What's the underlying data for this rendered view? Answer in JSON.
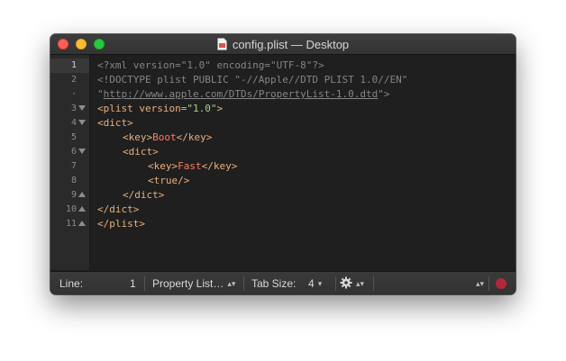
{
  "window": {
    "title": "config.plist — Desktop",
    "file_icon": "plist-document-icon"
  },
  "gutter": {
    "lines": [
      {
        "num": "1",
        "fold": "none",
        "current": true
      },
      {
        "num": "2",
        "fold": "none"
      },
      {
        "num": "·",
        "fold": "none"
      },
      {
        "num": "3",
        "fold": "open"
      },
      {
        "num": "4",
        "fold": "open"
      },
      {
        "num": "5",
        "fold": "none"
      },
      {
        "num": "6",
        "fold": "open"
      },
      {
        "num": "7",
        "fold": "none"
      },
      {
        "num": "8",
        "fold": "none"
      },
      {
        "num": "9",
        "fold": "close"
      },
      {
        "num": "10",
        "fold": "close"
      },
      {
        "num": "11",
        "fold": "close"
      }
    ]
  },
  "code": {
    "l1": "<?xml version=\"1.0\" encoding=\"UTF-8\"?>",
    "l2": "<!DOCTYPE plist PUBLIC \"-//Apple//DTD PLIST 1.0//EN\"",
    "l2b_q1": "\"",
    "l2b_url": "http://www.apple.com/DTDs/PropertyList-1.0.dtd",
    "l2b_q2": "\">",
    "l3_open": "<plist ",
    "l3_attr": "version=",
    "l3_val": "\"1.0\"",
    "l3_close": ">",
    "l4": "<dict>",
    "l5_open": "<key>",
    "l5_txt": "Boot",
    "l5_close": "</key>",
    "l6": "<dict>",
    "l7_open": "<key>",
    "l7_txt": "Fast",
    "l7_close": "</key>",
    "l8": "<true/>",
    "l9": "</dict>",
    "l10": "</dict>",
    "l11": "</plist>"
  },
  "status": {
    "line_label": "Line:",
    "line_value": "1",
    "syntax": "Property List…",
    "tab_label": "Tab Size:",
    "tab_value": "4",
    "gear_icon": "gear-icon",
    "stop_color": "#b0283a"
  }
}
